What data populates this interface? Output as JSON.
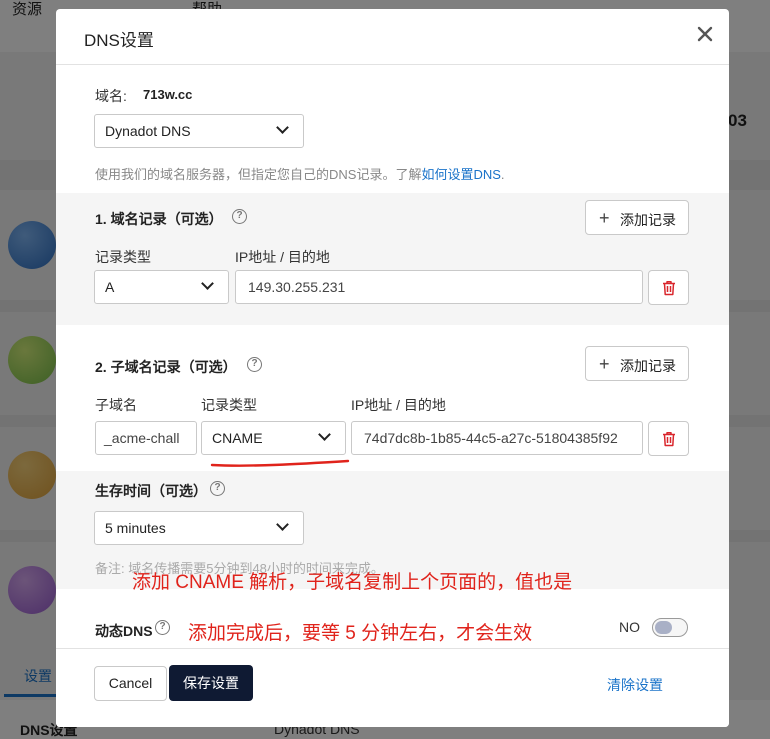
{
  "background": {
    "nav": [
      "资源",
      "帮助"
    ],
    "partial_number": "03",
    "tab_label": "设置",
    "bottom_label": "DNS设置",
    "bottom_value": "Dynadot DNS"
  },
  "modal": {
    "title": "DNS设置",
    "domain_label": "域名:",
    "domain_value": "713w.cc",
    "dns_provider": "Dynadot DNS",
    "help_text_prefix": "使用我们的域名服务器，但指定您自己的DNS记录。了解",
    "help_link": "如何设置DNS",
    "help_text_suffix": ".",
    "domain_records": {
      "title": "1. 域名记录（可选）",
      "add_label": "添加记录",
      "col_type": "记录类型",
      "col_ip": "IP地址 / 目的地",
      "type_value": "A",
      "ip_value": "149.30.255.231"
    },
    "subdomain_records": {
      "title": "2. 子域名记录（可选）",
      "add_label": "添加记录",
      "col_sub": "子域名",
      "col_type": "记录类型",
      "col_ip": "IP地址 / 目的地",
      "sub_value": "_acme-chall",
      "type_value": "CNAME",
      "ip_value": "74d7dc8b-1b85-44c5-a27c-51804385f92"
    },
    "ttl": {
      "title": "生存时间（可选）",
      "value": "5 minutes",
      "note": "备注: 域名传播需要5分钟到48小时的时间来完成。"
    },
    "dynamic_dns": {
      "title": "动态DNS",
      "toggle_label": "NO"
    },
    "annotations": {
      "line1": "添加 CNAME 解析，子域名复制上个页面的，值也是",
      "line2": "添加完成后，要等 5 分钟左右，才会生效"
    },
    "footer": {
      "cancel": "Cancel",
      "save": "保存设置",
      "clear": "清除设置"
    }
  },
  "colors": {
    "accent_link": "#1a73c9",
    "primary_button": "#0f1a33",
    "annotation": "#e0231b"
  }
}
